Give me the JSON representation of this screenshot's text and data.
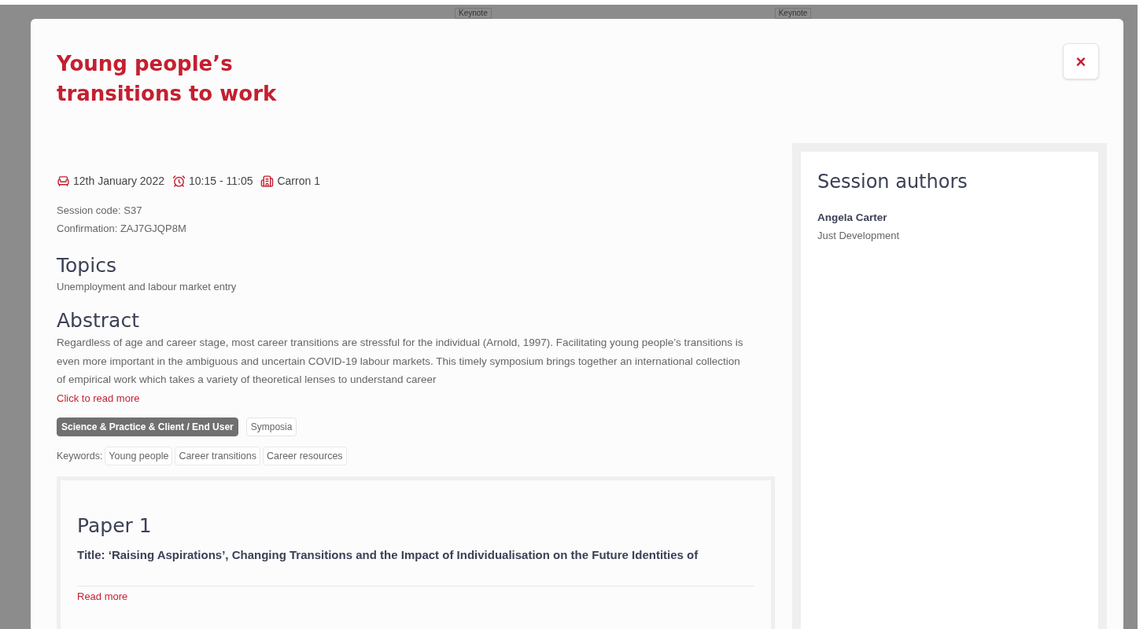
{
  "background_tags": [
    "Keynote",
    "Keynote"
  ],
  "modal": {
    "title": "Young people’s transitions to work",
    "close_label": "×",
    "meta": {
      "date": "12th January 2022",
      "time": "10:15 - 11:05",
      "room": "Carron 1"
    },
    "session_code": "Session code: S37",
    "confirmation": "Confirmation: ZAJ7GJQP8M",
    "topics": {
      "heading": "Topics",
      "text": "Unemployment and labour market entry"
    },
    "abstract": {
      "heading": "Abstract",
      "text": "Regardless of age and career stage, most career transitions are stressful for the individual (Arnold, 1997). Facilitating young people’s transitions is even more important in the ambiguous and uncertain COVID-19 labour markets. This timely symposium brings together an international collection of empirical work which takes a variety of theoretical lenses to understand career",
      "link": "Click to read more"
    },
    "tags": [
      {
        "label": "Science & Practice & Client / End User",
        "kind": "filled"
      },
      {
        "label": "Symposia",
        "kind": "outline"
      }
    ],
    "keywords": {
      "label": "Keywords:",
      "items": [
        "Young people",
        "Career transitions",
        "Career resources"
      ]
    },
    "papers": [
      {
        "heading": "Paper 1",
        "title": "Title: ‘Raising Aspirations’, Changing Transitions and the Impact of Individualisation on the Future Identities of",
        "link": "Read more"
      }
    ],
    "authors": {
      "heading": "Session authors",
      "items": [
        {
          "name": "Angela Carter",
          "org": "Just Development"
        }
      ]
    }
  }
}
